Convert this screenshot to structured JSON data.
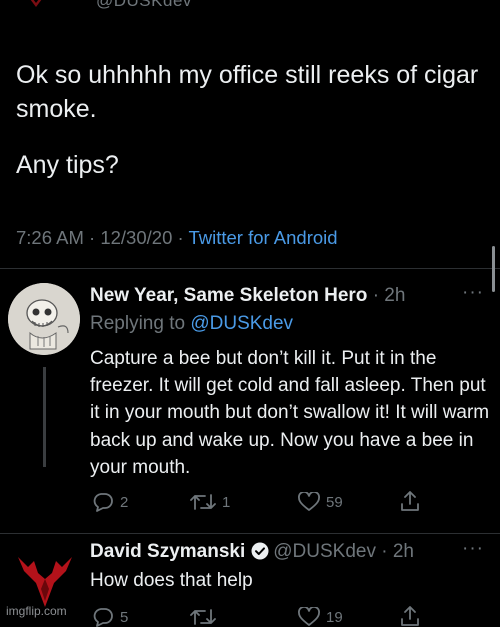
{
  "top_handle": "@DUSKdev",
  "main_tweet": {
    "lines": [
      "Ok so uhhhhh my office still reeks of cigar smoke.",
      "Any tips?"
    ],
    "time": "7:26 AM",
    "date": "12/30/20",
    "source": "Twitter for Android"
  },
  "reply1": {
    "name": "New Year, Same Skeleton Hero",
    "time": "2h",
    "replying_prefix": "Replying to",
    "replying_handle": "@DUSKdev",
    "text": "Capture a bee but don’t kill it. Put it in the freezer. It will get cold and fall asleep. Then put it in your mouth but don’t swallow it! It will warm back up and wake up. Now you have a bee in your mouth.",
    "replies": "2",
    "retweets": "1",
    "likes": "59",
    "more": "···"
  },
  "reply2": {
    "name": "David Szymanski",
    "handle": "@DUSKdev",
    "time": "2h",
    "text": "How does that help",
    "replies": "5",
    "retweets": "",
    "likes": "19",
    "more": "···"
  },
  "watermark": "imgflip.com",
  "colors": {
    "background": "#000000",
    "text": "#e7e9ea",
    "secondary": "#6f767b",
    "link": "#4a9ae6",
    "avatar_red": "#b3121a"
  },
  "icons": [
    "reply-icon",
    "retweet-icon",
    "like-icon",
    "share-icon",
    "verified-icon"
  ]
}
